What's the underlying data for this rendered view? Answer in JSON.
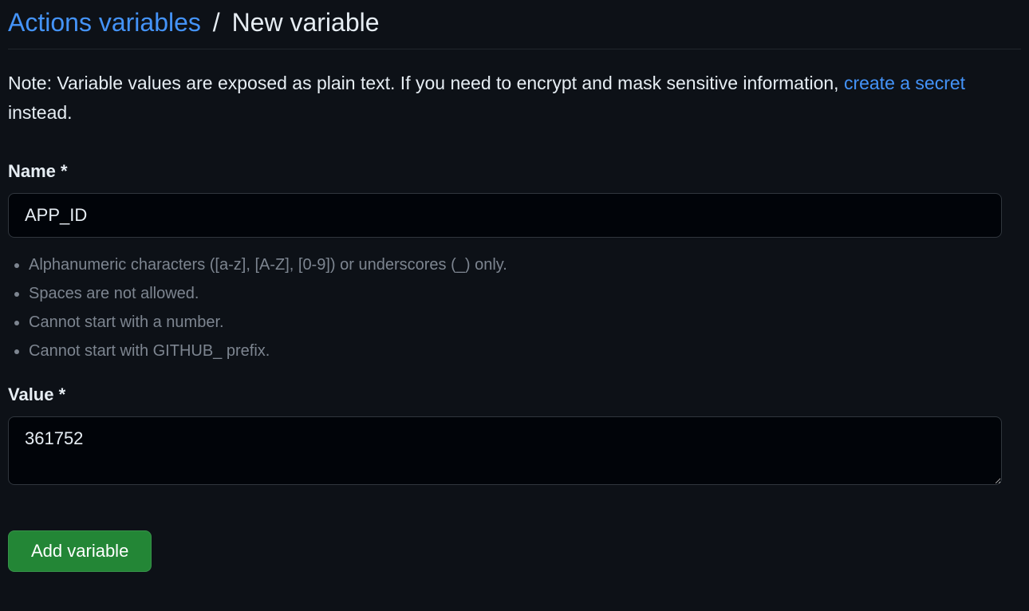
{
  "breadcrumb": {
    "parent": "Actions variables",
    "separator": "/",
    "current": "New variable"
  },
  "note": {
    "prefix": "Note: Variable values are exposed as plain text. If you need to encrypt and mask sensitive information, ",
    "link_text": "create a secret",
    "suffix": " instead."
  },
  "form": {
    "name": {
      "label": "Name *",
      "value": "APP_ID",
      "hints": [
        "Alphanumeric characters ([a-z], [A-Z], [0-9]) or underscores (_) only.",
        "Spaces are not allowed.",
        "Cannot start with a number.",
        "Cannot start with GITHUB_ prefix."
      ]
    },
    "value": {
      "label": "Value *",
      "value": "361752"
    },
    "submit_label": "Add variable"
  }
}
